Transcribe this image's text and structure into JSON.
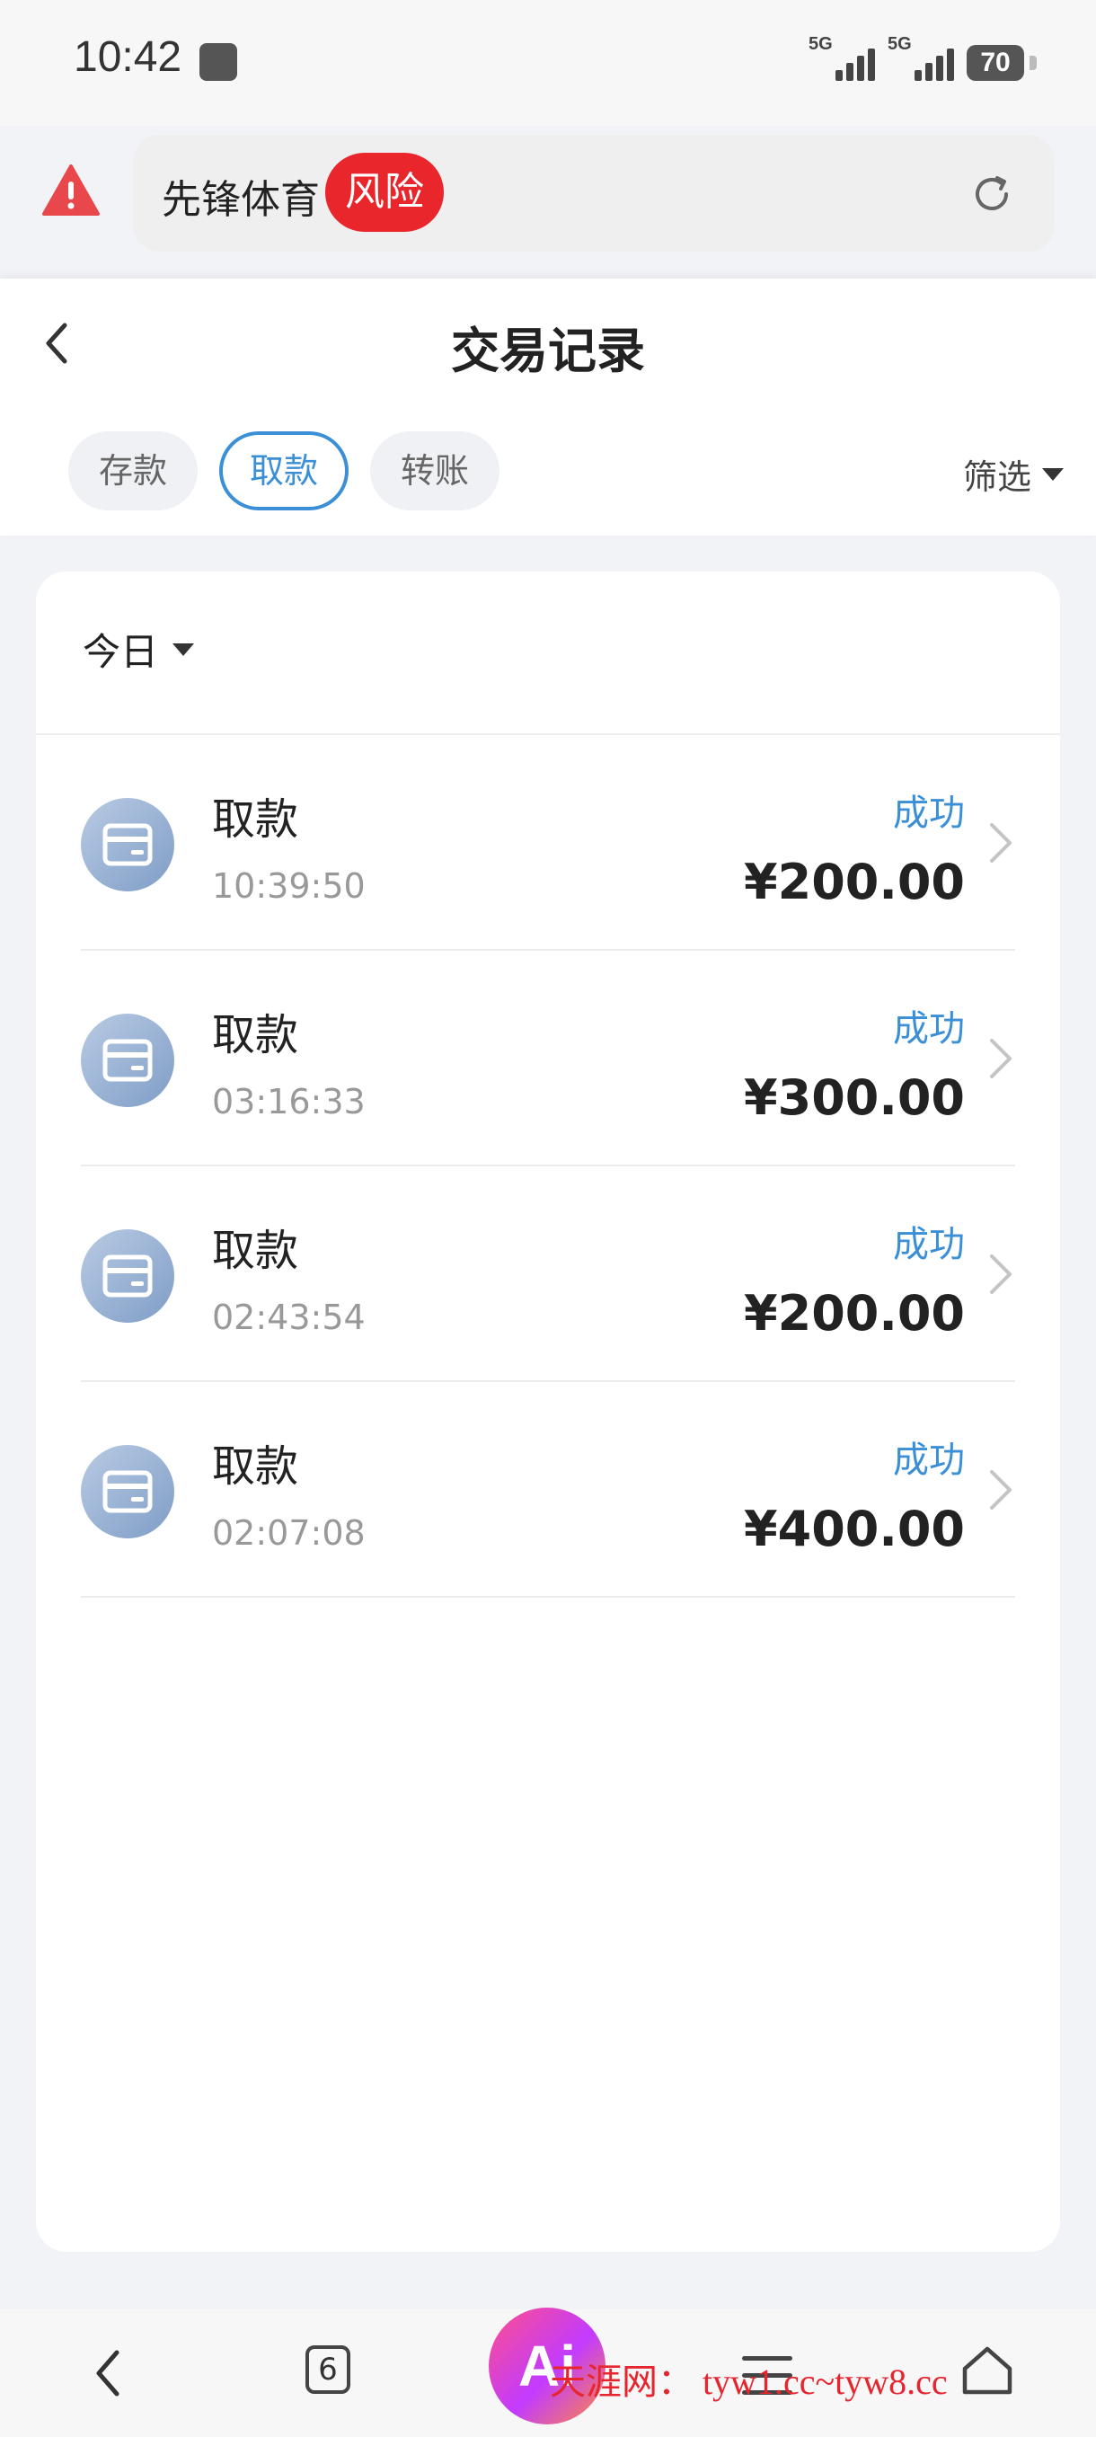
{
  "status_bar": {
    "time": "10:42",
    "network_1": "5G",
    "network_2": "5G",
    "battery": "70"
  },
  "browser": {
    "site_name": "先锋体育",
    "risk_label": "风险"
  },
  "header": {
    "title": "交易记录"
  },
  "tabs": [
    {
      "label": "存款",
      "active": false
    },
    {
      "label": "取款",
      "active": true
    },
    {
      "label": "转账",
      "active": false
    }
  ],
  "filter": {
    "label": "筛选"
  },
  "date_selector": {
    "label": "今日"
  },
  "records": [
    {
      "type": "取款",
      "time": "10:39:50",
      "status": "成功",
      "amount": "¥200.00"
    },
    {
      "type": "取款",
      "time": "03:16:33",
      "status": "成功",
      "amount": "¥300.00"
    },
    {
      "type": "取款",
      "time": "02:43:54",
      "status": "成功",
      "amount": "¥200.00"
    },
    {
      "type": "取款",
      "time": "02:07:08",
      "status": "成功",
      "amount": "¥400.00"
    }
  ],
  "bottom_nav": {
    "tab_count": "6"
  },
  "watermark": {
    "text": "天涯网： tyw1.cc~tyw8.cc"
  },
  "colors": {
    "accent": "#3a8fd6",
    "risk": "#e8262b",
    "warning": "#e8474b"
  }
}
